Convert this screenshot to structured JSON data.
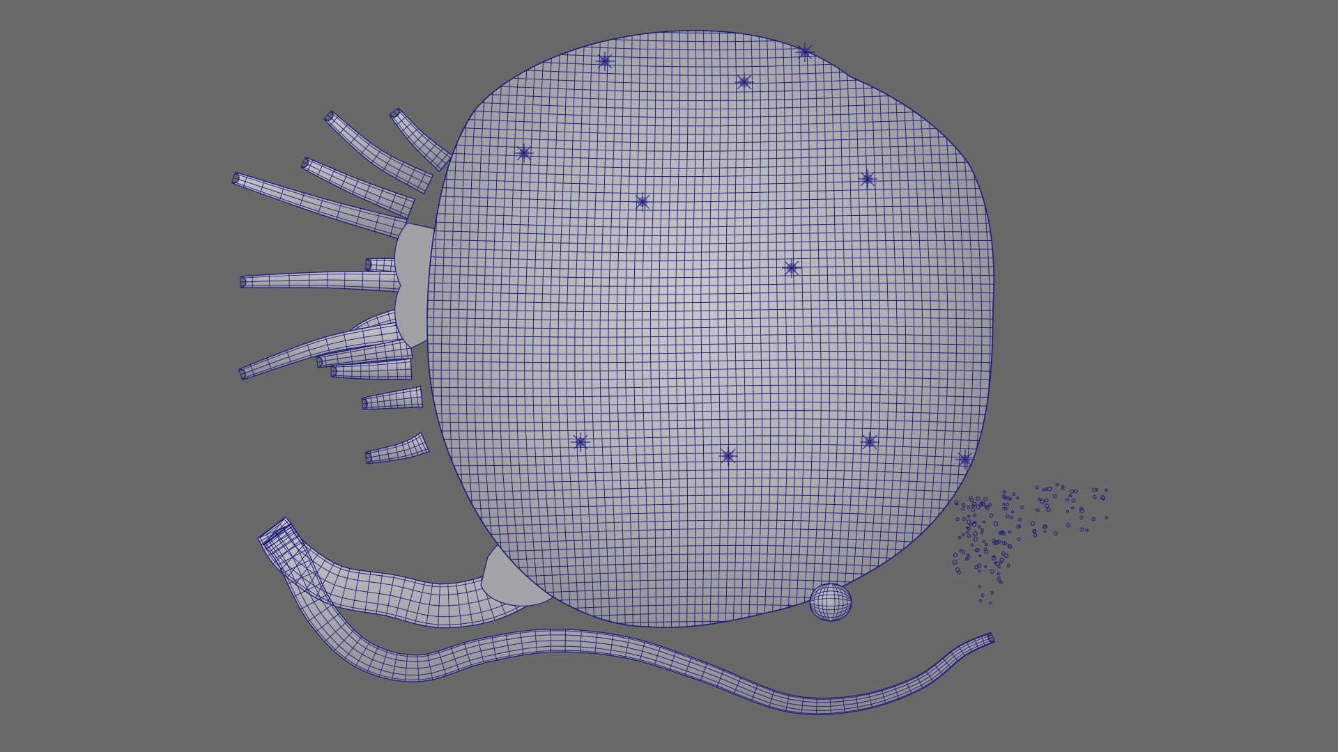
{
  "viewport": {
    "background": "#686868",
    "wire_color": "#1c1a78",
    "shade_light": "#c4c4c8",
    "shade_mid": "#a9a9ad",
    "shade_dark": "#7f7f84"
  },
  "model": {
    "parts": [
      "body",
      "tentacles",
      "tail",
      "bulb",
      "particles"
    ]
  }
}
